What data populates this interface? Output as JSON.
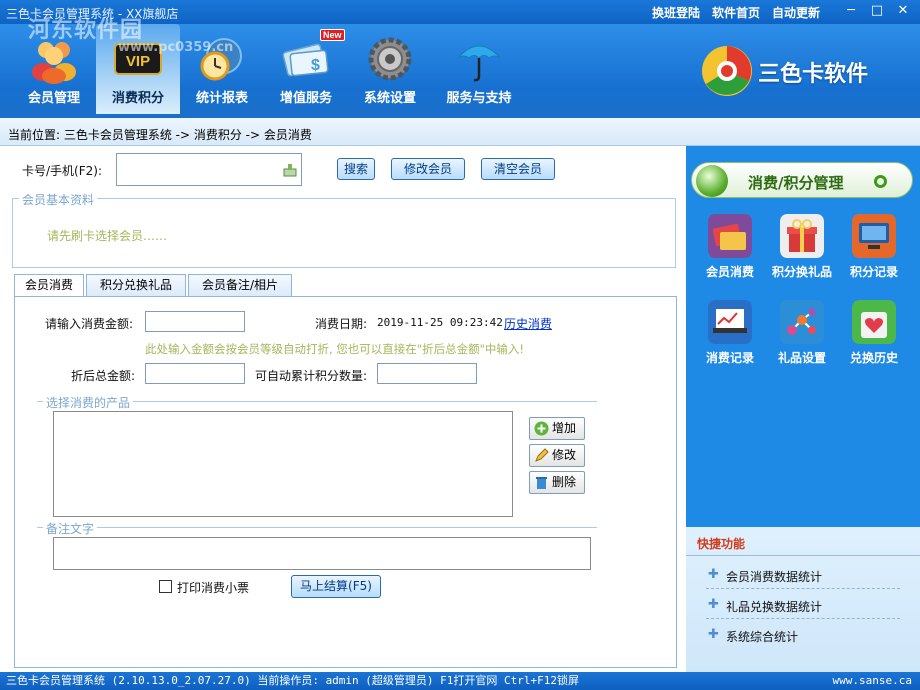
{
  "window": {
    "title": "三色卡会员管理系统 - XX旗舰店",
    "watermark": "河东软件园",
    "watermark_url": "www.pc0359.cn",
    "links": [
      "换班登陆",
      "软件首页",
      "自动更新"
    ],
    "controls": {
      "minimize": "─",
      "maximize": "□",
      "close": "✕"
    }
  },
  "nav": {
    "items": [
      {
        "label": "会员管理",
        "icon": "members-icon"
      },
      {
        "label": "消费积分",
        "icon": "vip-card-icon",
        "active": true
      },
      {
        "label": "统计报表",
        "icon": "clock-report-icon"
      },
      {
        "label": "增值服务",
        "icon": "value-added-service-icon",
        "badge": "New"
      },
      {
        "label": "系统设置",
        "icon": "gear-icon"
      },
      {
        "label": "服务与支持",
        "icon": "umbrella-icon"
      }
    ],
    "brand": "三色卡软件"
  },
  "breadcrumb": "当前位置: 三色卡会员管理系统 -> 消费积分 -> 会员消费",
  "search": {
    "label": "卡号/手机(F2):",
    "value": "",
    "buttons": {
      "search": "搜索",
      "edit_member": "修改会员",
      "clear_member": "清空会员"
    }
  },
  "member_info": {
    "caption": "会员基本资料",
    "prompt": "请先刷卡选择会员……"
  },
  "tabs": [
    {
      "label": "会员消费",
      "active": true
    },
    {
      "label": "积分兑换礼品"
    },
    {
      "label": "会员备注/相片"
    }
  ],
  "consume": {
    "amount_label": "请输入消费金额:",
    "amount_value": "",
    "date_label": "消费日期:",
    "date_value": "2019-11-25 09:23:42",
    "history_link": "历史消费",
    "hint": "此处输入金额会按会员等级自动打折, 您也可以直接在\"折后总金额\"中输入!",
    "discount_label": "折后总金额:",
    "discount_value": "",
    "points_label": "可自动累计积分数量:",
    "points_value": "",
    "products_caption": "选择消费的产品",
    "product_buttons": {
      "add": "增加",
      "edit": "修改",
      "delete": "删除"
    },
    "note_caption": "备注文字",
    "note_value": "",
    "print_label": "打印消费小票",
    "print_checked": false,
    "checkout_button": "马上结算(F5)"
  },
  "right_panel": {
    "title": "消费/积分管理",
    "items": [
      {
        "label": "会员消费",
        "icon": "card-payment-icon"
      },
      {
        "label": "积分换礼品",
        "icon": "gift-icon"
      },
      {
        "label": "积分记录",
        "icon": "computer-record-icon"
      },
      {
        "label": "消费记录",
        "icon": "laptop-chart-icon"
      },
      {
        "label": "礼品设置",
        "icon": "network-settings-icon"
      },
      {
        "label": "兑换历史",
        "icon": "heart-bag-icon"
      }
    ],
    "quick_title": "快捷功能",
    "quick_items": [
      "会员消费数据统计",
      "礼品兑换数据统计",
      "系统综合统计"
    ]
  },
  "status": {
    "left": "三色卡会员管理系统 (2.10.13.0_2.07.27.0)  当前操作员: admin (超级管理员)  F1打开官网 Ctrl+F12锁屏",
    "right": "www.sanse.ca"
  }
}
